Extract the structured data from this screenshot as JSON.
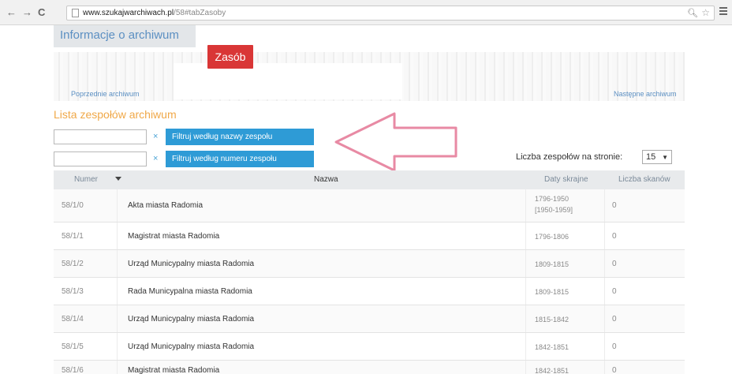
{
  "browser": {
    "back": "←",
    "forward": "→",
    "reload": "C",
    "url_host": "www.szukajwarchiwach.pl",
    "url_path": "/58#tabZasoby"
  },
  "header": {
    "info_tab": "Informacje o archiwum",
    "zasob_button": "Zasób",
    "prev_link": "Poprzednie archiwum",
    "next_link": "Następne archiwum"
  },
  "section": {
    "title": "Lista zespołów archiwum"
  },
  "filters": {
    "by_name_button": "Filtruj według nazwy zespołu",
    "by_number_button": "Filtruj według numeru zespołu",
    "clear": "×",
    "name_value": "",
    "number_value": ""
  },
  "pagination": {
    "per_page_label": "Liczba zespołów na stronie:",
    "per_page_value": "15"
  },
  "table": {
    "headers": {
      "numer": "Numer",
      "nazwa": "Nazwa",
      "daty": "Daty skrajne",
      "skany": "Liczba skanów"
    },
    "rows": [
      {
        "numer": "58/1/0",
        "nazwa": "Akta miasta Radomia",
        "daty": "1796-1950",
        "daty2": "[1950-1959]",
        "skany": "0"
      },
      {
        "numer": "58/1/1",
        "nazwa": "Magistrat miasta Radomia",
        "daty": "1796-1806",
        "daty2": "",
        "skany": "0"
      },
      {
        "numer": "58/1/2",
        "nazwa": "Urząd Municypalny miasta Radomia",
        "daty": "1809-1815",
        "daty2": "",
        "skany": "0"
      },
      {
        "numer": "58/1/3",
        "nazwa": "Rada Municypalna miasta Radomia",
        "daty": "1809-1815",
        "daty2": "",
        "skany": "0"
      },
      {
        "numer": "58/1/4",
        "nazwa": "Urząd Municypalny miasta Radomia",
        "daty": "1815-1842",
        "daty2": "",
        "skany": "0"
      },
      {
        "numer": "58/1/5",
        "nazwa": "Urząd Municypalny miasta Radomia",
        "daty": "1842-1851",
        "daty2": "",
        "skany": "0"
      },
      {
        "numer": "58/1/6",
        "nazwa": "Magistrat miasta Radomia",
        "daty": "1842-1851",
        "daty2": "",
        "skany": "0"
      }
    ]
  },
  "colors": {
    "accent_blue": "#2e9bd6",
    "zasob_red": "#d93636",
    "title_orange": "#f0a848",
    "arrow_pink": "#e88aa4"
  }
}
